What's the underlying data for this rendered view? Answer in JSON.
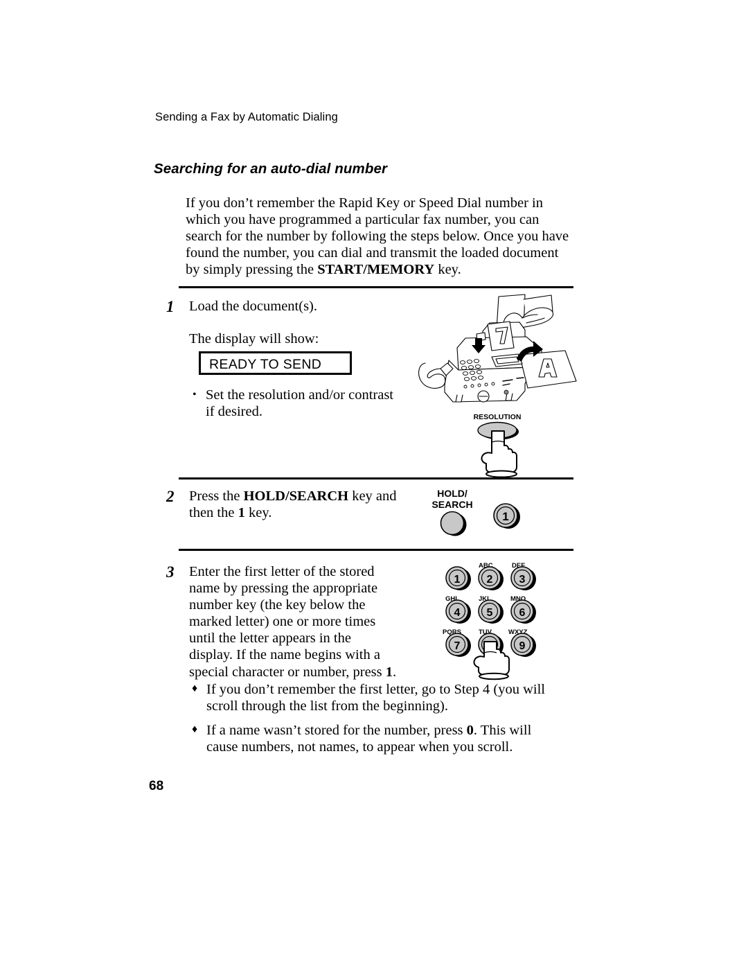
{
  "page": {
    "running_header": "Sending a Fax by Automatic Dialing",
    "section_heading": "Searching for an auto-dial number",
    "page_number": "68"
  },
  "intro": {
    "text_before_bold": "If you don’t remember the Rapid Key or Speed Dial number in which you have programmed a particular fax number, you can search for the number by following the steps below. Once you have found the number, you can dial and transmit the loaded document by simply pressing the ",
    "bold_term": "START/MEMORY",
    "text_after_bold": " key."
  },
  "steps": {
    "step1": {
      "number": "1",
      "line1": "Load the document(s).",
      "line2": "The display will show:",
      "display_value": "READY TO SEND",
      "bullet_char": "•",
      "bullet_text": "Set the resolution and/or contrast if desired."
    },
    "step2": {
      "number": "2",
      "text_1": "Press the ",
      "bold_key": "HOLD/SEARCH",
      "text_2": " key and then the ",
      "bold_key2": "1",
      "text_3": " key."
    },
    "step3": {
      "number": "3",
      "text_1": "Enter the first letter of the stored name by pressing the appropriate number key (the key below the marked letter) one or more times until the letter appears in the display. If the name begins with a special character or number, press ",
      "bold_key": "1",
      "text_2": "."
    }
  },
  "notes": [
    {
      "bullet_char": "♦",
      "text_1": "If you don’t remember the first letter, go to Step 4 (you will scroll through the list from the beginning).",
      "bold_key": "",
      "text_2": ""
    },
    {
      "bullet_char": "♦",
      "text_1": "If a name wasn’t stored for the number, press ",
      "bold_key": "0",
      "text_2": ". This will cause numbers, not names, to appear when you scroll."
    }
  ],
  "illustrations": {
    "fax_machine": {
      "name": "fax-machine-loading-document"
    },
    "resolution_button": {
      "label": "RESOLUTION"
    },
    "hold_search_button": {
      "label_line1": "HOLD/",
      "label_line2": "SEARCH",
      "adjacent_key_label": "1"
    },
    "keypad": {
      "keys": [
        {
          "digit": "1",
          "letters": ""
        },
        {
          "digit": "2",
          "letters": "ABC"
        },
        {
          "digit": "3",
          "letters": "DEF"
        },
        {
          "digit": "4",
          "letters": "GHI"
        },
        {
          "digit": "5",
          "letters": "JKL"
        },
        {
          "digit": "6",
          "letters": "MNO"
        },
        {
          "digit": "7",
          "letters": "PQRS"
        },
        {
          "digit": "8",
          "letters": "TUV"
        },
        {
          "digit": "9",
          "letters": "WXYZ"
        }
      ],
      "pressed_key": "8"
    }
  },
  "colors": {
    "button_fill": "#c8c8c8",
    "button_stroke": "#000000",
    "text": "#000000",
    "page_background": "#ffffff"
  }
}
